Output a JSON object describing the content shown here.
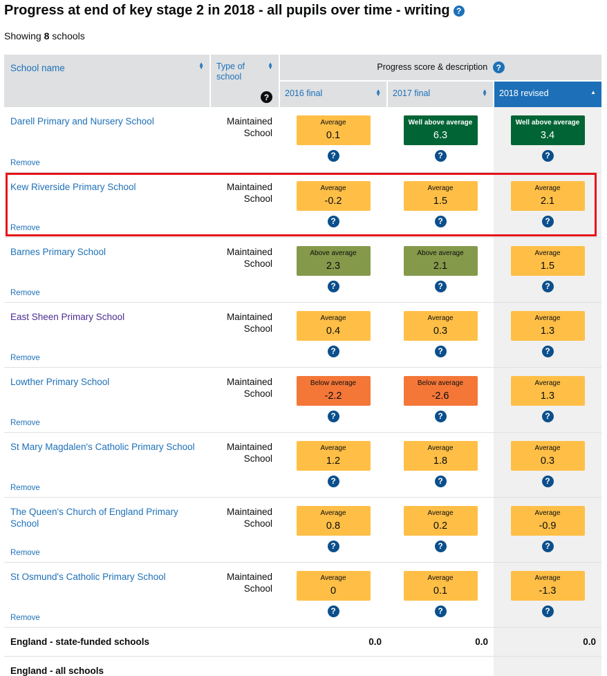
{
  "title": "Progress at end of key stage 2 in 2018 - all pupils over time - writing",
  "showing": {
    "prefix": "Showing",
    "count": "8",
    "suffix": "schools"
  },
  "headers": {
    "school_name": "School name",
    "type_of_school": "Type of school",
    "group": "Progress score & description",
    "year1": "2016 final",
    "year2": "2017 final",
    "year3": "2018 revised"
  },
  "remove_label": "Remove",
  "schools": [
    {
      "name": "Darell Primary and Nursery School",
      "type": "Maintained School",
      "scores": [
        {
          "desc": "Average",
          "value": "0.1",
          "kind": "avg"
        },
        {
          "desc": "Well above average",
          "value": "6.3",
          "kind": "well-above"
        },
        {
          "desc": "Well above average",
          "value": "3.4",
          "kind": "well-above"
        }
      ]
    },
    {
      "name": "Kew Riverside Primary School",
      "type": "Maintained School",
      "scores": [
        {
          "desc": "Average",
          "value": "-0.2",
          "kind": "avg"
        },
        {
          "desc": "Average",
          "value": "1.5",
          "kind": "avg"
        },
        {
          "desc": "Average",
          "value": "2.1",
          "kind": "avg"
        }
      ]
    },
    {
      "name": "Barnes Primary School",
      "type": "Maintained School",
      "scores": [
        {
          "desc": "Above average",
          "value": "2.3",
          "kind": "above"
        },
        {
          "desc": "Above average",
          "value": "2.1",
          "kind": "above"
        },
        {
          "desc": "Average",
          "value": "1.5",
          "kind": "avg"
        }
      ]
    },
    {
      "name": "East Sheen Primary School",
      "type": "Maintained School",
      "visited": true,
      "scores": [
        {
          "desc": "Average",
          "value": "0.4",
          "kind": "avg"
        },
        {
          "desc": "Average",
          "value": "0.3",
          "kind": "avg"
        },
        {
          "desc": "Average",
          "value": "1.3",
          "kind": "avg"
        }
      ]
    },
    {
      "name": "Lowther Primary School",
      "type": "Maintained School",
      "scores": [
        {
          "desc": "Below average",
          "value": "-2.2",
          "kind": "below"
        },
        {
          "desc": "Below average",
          "value": "-2.6",
          "kind": "below"
        },
        {
          "desc": "Average",
          "value": "1.3",
          "kind": "avg"
        }
      ]
    },
    {
      "name": "St Mary Magdalen's Catholic Primary School",
      "type": "Maintained School",
      "scores": [
        {
          "desc": "Average",
          "value": "1.2",
          "kind": "avg"
        },
        {
          "desc": "Average",
          "value": "1.8",
          "kind": "avg"
        },
        {
          "desc": "Average",
          "value": "0.3",
          "kind": "avg"
        }
      ]
    },
    {
      "name": "The Queen's Church of England Primary School",
      "type": "Maintained School",
      "scores": [
        {
          "desc": "Average",
          "value": "0.8",
          "kind": "avg"
        },
        {
          "desc": "Average",
          "value": "0.2",
          "kind": "avg"
        },
        {
          "desc": "Average",
          "value": "-0.9",
          "kind": "avg"
        }
      ]
    },
    {
      "name": "St Osmund's Catholic Primary School",
      "type": "Maintained School",
      "scores": [
        {
          "desc": "Average",
          "value": "0",
          "kind": "avg"
        },
        {
          "desc": "Average",
          "value": "0.1",
          "kind": "avg"
        },
        {
          "desc": "Average",
          "value": "-1.3",
          "kind": "avg"
        }
      ]
    }
  ],
  "summary": [
    {
      "label": "England - state-funded schools",
      "values": [
        "0.0",
        "0.0",
        "0.0"
      ]
    },
    {
      "label": "England - all schools",
      "values": [
        "",
        "",
        ""
      ]
    }
  ],
  "colors": {
    "average": "#ffbf47",
    "well_above_average": "#006435",
    "above_average": "#85994b",
    "below_average": "#f47738",
    "link": "#1d70b8",
    "highlight": "#e5121a"
  },
  "icons": {
    "help": "question-circle-icon",
    "sort": "sort-arrows-icon"
  }
}
